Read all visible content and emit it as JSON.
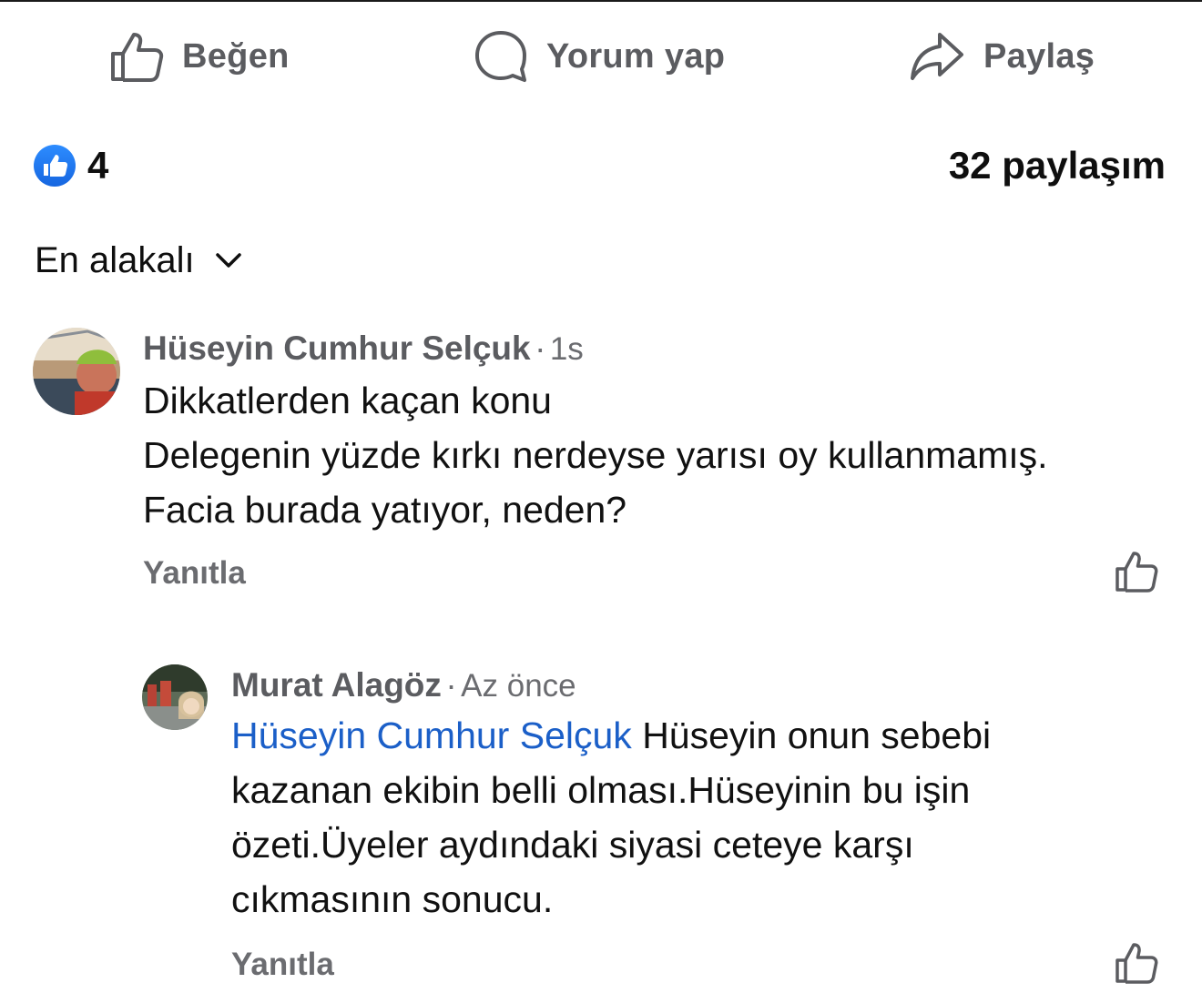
{
  "actions": {
    "like_label": "Beğen",
    "comment_label": "Yorum yap",
    "share_label": "Paylaş",
    "icon_color": "#5b5c60"
  },
  "stats": {
    "like_count": "4",
    "share_count": "32 paylaşım",
    "like_badge_color": "#1877f2"
  },
  "sort": {
    "label": "En alakalı"
  },
  "comments": [
    {
      "author": "Hüseyin Cumhur Selçuk",
      "separator": "·",
      "time": "1s",
      "lines": [
        "Dikkatlerden kaçan konu",
        "Delegenin yüzde kırkı nerdeyse yarısı oy kullanmamış.",
        "Facia burada yatıyor, neden?"
      ],
      "reply_label": "Yanıtla"
    }
  ],
  "replies": [
    {
      "author": "Murat Alagöz",
      "separator": "·",
      "time": "Az önce",
      "mention": "Hüseyin Cumhur Selçuk",
      "first_line_rest": " Hüseyin onun sebebi",
      "lines": [
        "kazanan ekibin belli olması.Hüseyinin bu işin",
        "özeti.Üyeler aydındaki siyasi ceteye karşı",
        "cıkmasının sonucu."
      ],
      "reply_label": "Yanıtla"
    }
  ],
  "colors": {
    "mention": "#1b5fc8",
    "secondary_text": "#5b5c60"
  }
}
